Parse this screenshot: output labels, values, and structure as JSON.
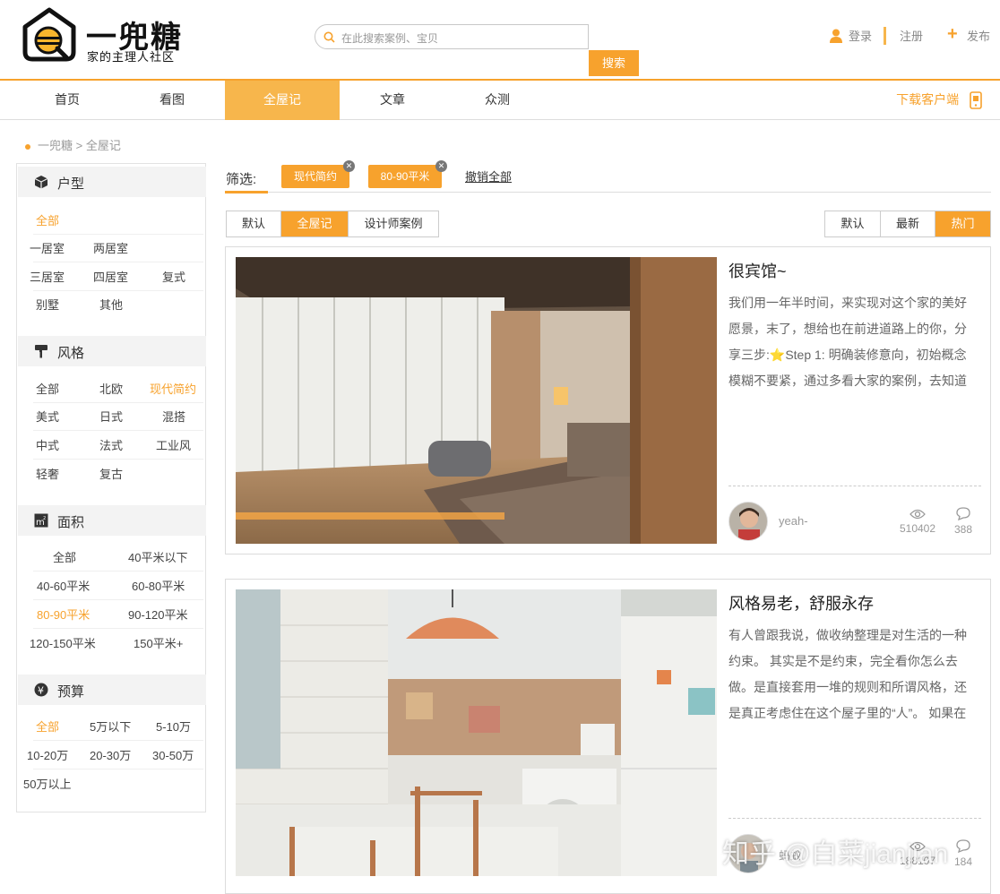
{
  "header": {
    "logo_title": "一兜糖",
    "logo_subtitle": "家的主理人社区",
    "search_placeholder": "在此搜索案例、宝贝",
    "search_button": "搜索",
    "login": "登录",
    "register": "注册",
    "publish": "发布"
  },
  "nav": {
    "items": [
      "首页",
      "看图",
      "全屋记",
      "文章",
      "众测"
    ],
    "active_index": 2,
    "download": "下载客户端"
  },
  "breadcrumb": {
    "home": "一兜糖",
    "separator": ">",
    "current": "全屋记"
  },
  "sidebar": {
    "huxing": {
      "title": "户型",
      "options": [
        "全部",
        "一居室",
        "两居室",
        "三居室",
        "四居室",
        "复式",
        "别墅",
        "其他"
      ],
      "selected": "全部"
    },
    "fengge": {
      "title": "风格",
      "options": [
        "全部",
        "北欧",
        "现代简约",
        "美式",
        "日式",
        "混搭",
        "中式",
        "法式",
        "工业风",
        "轻奢",
        "复古"
      ],
      "selected": "现代简约"
    },
    "mianji": {
      "title": "面积",
      "options": [
        "全部",
        "40平米以下",
        "40-60平米",
        "60-80平米",
        "80-90平米",
        "90-120平米",
        "120-150平米",
        "150平米+"
      ],
      "selected": "80-90平米"
    },
    "yusuan": {
      "title": "预算",
      "options": [
        "全部",
        "5万以下",
        "5-10万",
        "10-20万",
        "20-30万",
        "30-50万",
        "50万以上"
      ],
      "selected": "全部"
    }
  },
  "filters": {
    "label": "筛选:",
    "tags": [
      "现代简约",
      "80-90平米"
    ],
    "clear_all": "撤销全部"
  },
  "tabs_left": {
    "items": [
      "默认",
      "全屋记",
      "设计师案例"
    ],
    "active_index": 1
  },
  "tabs_right": {
    "items": [
      "默认",
      "最新",
      "热门"
    ],
    "active_index": 2
  },
  "cards": [
    {
      "title": "很宾馆~",
      "excerpt": "我们用一年半时间，来实现对这个家的美好愿景，末了，想给也在前进道路上的你，分享三步:⭐Step 1: 明确装修意向，初始概念模糊不要紧，通过多看大家的案例，去知道",
      "author": "yeah-",
      "views": "510402",
      "comments": "388"
    },
    {
      "title": "风格易老，舒服永存",
      "excerpt": "有人曾跟我说，做收纳整理是对生活的一种约束。 其实是不是约束，完全看你怎么去做。是直接套用一堆的规则和所谓风格，还是真正考虑住在这个屋子里的“人”。 如果在",
      "author": "蚂蚁",
      "views": "188107",
      "comments": "184"
    }
  ],
  "watermark": "知乎 @白菜jianjian",
  "colors": {
    "accent": "#f7a22d",
    "nav_active": "#f7b64c"
  }
}
